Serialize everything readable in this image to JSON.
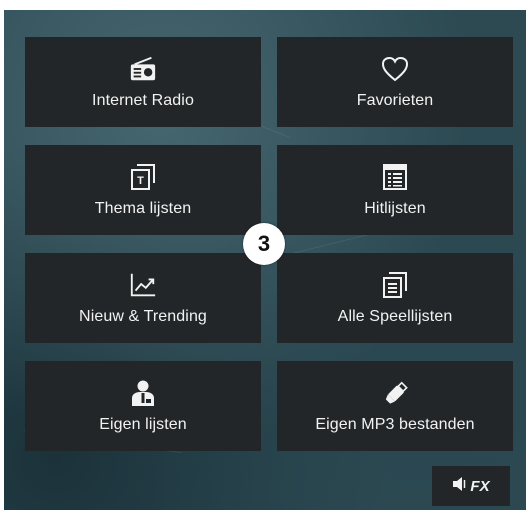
{
  "tiles": [
    {
      "label": "Internet Radio",
      "icon": "radio-icon"
    },
    {
      "label": "Favorieten",
      "icon": "heart-icon"
    },
    {
      "label": "Thema lijsten",
      "icon": "theme-list-icon"
    },
    {
      "label": "Hitlijsten",
      "icon": "chart-list-icon"
    },
    {
      "label": "Nieuw & Trending",
      "icon": "trending-icon"
    },
    {
      "label": "Alle Speellijsten",
      "icon": "playlists-icon"
    },
    {
      "label": "Eigen lijsten",
      "icon": "user-lists-icon"
    },
    {
      "label": "Eigen MP3 bestanden",
      "icon": "usb-icon"
    }
  ],
  "badge": {
    "number": "3"
  },
  "fx_button": {
    "label": "FX",
    "icon": "speaker-icon"
  },
  "colors": {
    "tile_bg": "#232628",
    "text": "#f2f2f2",
    "background": "#2d4a53"
  }
}
